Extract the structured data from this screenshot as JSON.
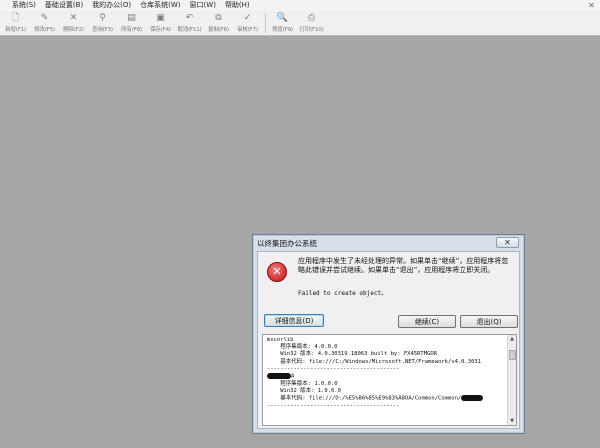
{
  "menubar": {
    "items": [
      {
        "label": "系统(S)"
      },
      {
        "label": "基础设置(B)"
      },
      {
        "label": "我的办公(O)"
      },
      {
        "label": "仓库系统(W)"
      },
      {
        "label": "窗口(W)"
      },
      {
        "label": "帮助(H)"
      }
    ],
    "close_glyph": "✕"
  },
  "toolbar": {
    "buttons": [
      {
        "label": "新增(F1)",
        "icon": "new-document-icon",
        "glyph": "🗋"
      },
      {
        "label": "修改(F5)",
        "icon": "edit-icon",
        "glyph": "✎"
      },
      {
        "label": "删除(F2)",
        "icon": "delete-icon",
        "glyph": "✕"
      },
      {
        "label": "查询(F3)",
        "icon": "binoculars-icon",
        "glyph": "⚲"
      },
      {
        "label": "所有(F8)",
        "icon": "list-all-icon",
        "glyph": "▤"
      },
      {
        "label": "保存(F4)",
        "icon": "save-icon",
        "glyph": "▣"
      },
      {
        "label": "取消(F11)",
        "icon": "undo-icon",
        "glyph": "↶"
      },
      {
        "label": "复制(F6)",
        "icon": "copy-icon",
        "glyph": "⧉"
      },
      {
        "label": "审核(F7)",
        "icon": "check-icon",
        "glyph": "✓"
      },
      {
        "label": "预览(F9)",
        "icon": "preview-icon",
        "glyph": "🔍"
      },
      {
        "label": "打印(F10)",
        "icon": "printer-icon",
        "glyph": "⎙"
      }
    ]
  },
  "dialog": {
    "title": "以终集团办公系统",
    "close_glyph": "✕",
    "message": "应用程序中发生了未经处理的异常。如果单击“继续”，应用程序将忽略此错误并尝试继续。如果单击“退出”，应用程序将立即关闭。",
    "detail": "Failed to create object。",
    "details_button": "详细信息(D)",
    "continue_button": "继续(C)",
    "quit_button": "退出(Q)",
    "detail_lines": [
      "mscorlib",
      "    程序集版本: 4.0.0.0",
      "    Win32 版本: 4.0.30319.18063 built by: FX45RTMGDR",
      "    基本代码: file:///C:/Windows/Microsoft.NET/Framework/v4.0.3031",
      "----------------------------------------",
      "A",
      "    程序集版本: 1.0.0.0",
      "    Win32 版本: 1.0.0.0",
      "    基本代码: file:///D:/%E5%86%85%E9%83%A8OA/Common/Common/",
      "----------------------------------------"
    ]
  },
  "colors": {
    "desktop_background": "#a6a6a6",
    "error_icon": "#c41010",
    "focused_button_border": "#3c7fb1"
  }
}
